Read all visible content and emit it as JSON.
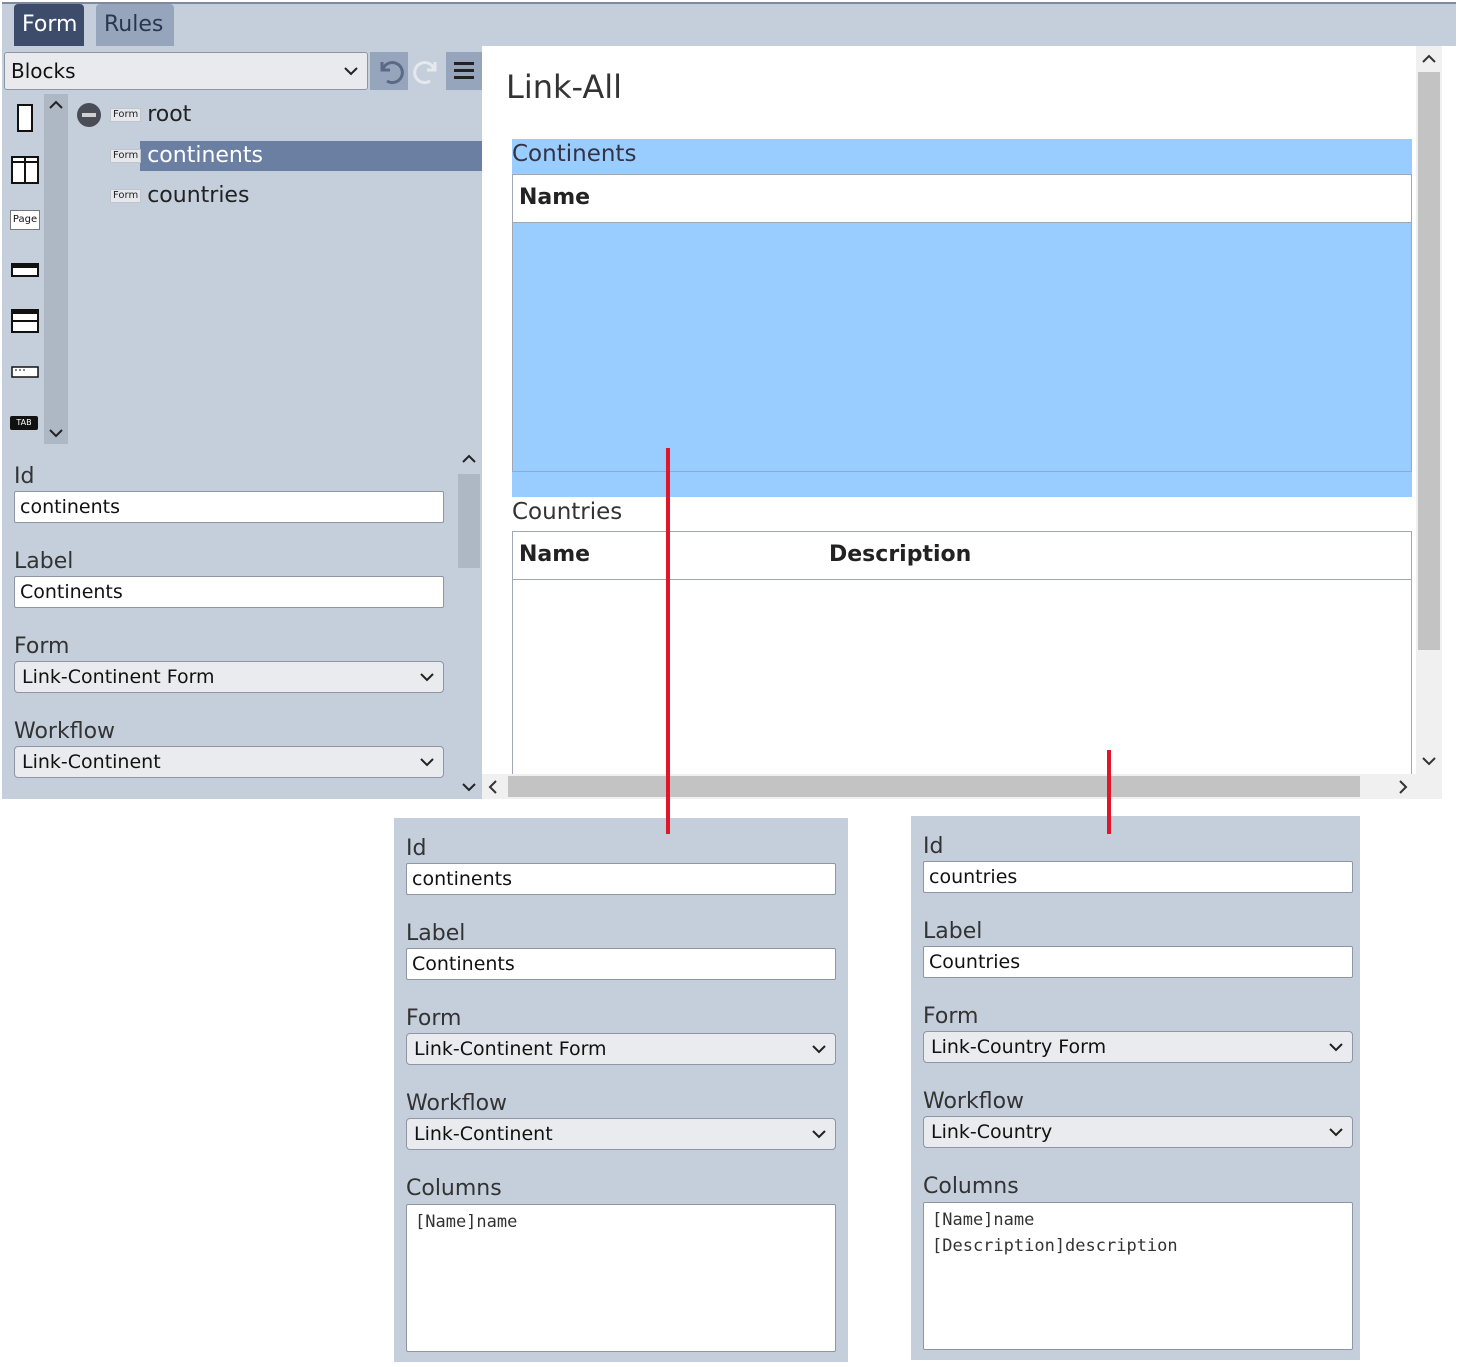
{
  "tabs": [
    {
      "label": "Form"
    },
    {
      "label": "Rules"
    }
  ],
  "toolbar": {
    "blocks_select": "Blocks"
  },
  "palette": {
    "page_label": "Page",
    "tab_label": "TAB"
  },
  "tree": {
    "tag": "Form",
    "items": [
      {
        "label": "root"
      },
      {
        "label": "continents"
      },
      {
        "label": "countries"
      }
    ]
  },
  "props_left": {
    "id_label": "Id",
    "id_value": "continents",
    "label_label": "Label",
    "label_value": "Continents",
    "form_label": "Form",
    "form_value": "Link-Continent Form",
    "workflow_label": "Workflow",
    "workflow_value": "Link-Continent"
  },
  "preview": {
    "title": "Link-All",
    "continents": {
      "caption": "Continents",
      "columns": [
        "Name"
      ]
    },
    "countries": {
      "caption": "Countries",
      "columns": [
        "Name",
        "Description"
      ]
    }
  },
  "callout_continents": {
    "id_label": "Id",
    "id_value": "continents",
    "label_label": "Label",
    "label_value": "Continents",
    "form_label": "Form",
    "form_value": "Link-Continent Form",
    "workflow_label": "Workflow",
    "workflow_value": "Link-Continent",
    "columns_label": "Columns",
    "columns_value": "[Name]name"
  },
  "callout_countries": {
    "id_label": "Id",
    "id_value": "countries",
    "label_label": "Label",
    "label_value": "Countries",
    "form_label": "Form",
    "form_value": "Link-Country Form",
    "workflow_label": "Workflow",
    "workflow_value": "Link-Country",
    "columns_label": "Columns",
    "columns_value": "[Name]name\n[Description]description"
  },
  "colors": {
    "selection_blue": "#99ccff",
    "panel": "#c5cfdc",
    "tab_active": "#3e4c6b",
    "connector_red": "#e0162b"
  }
}
